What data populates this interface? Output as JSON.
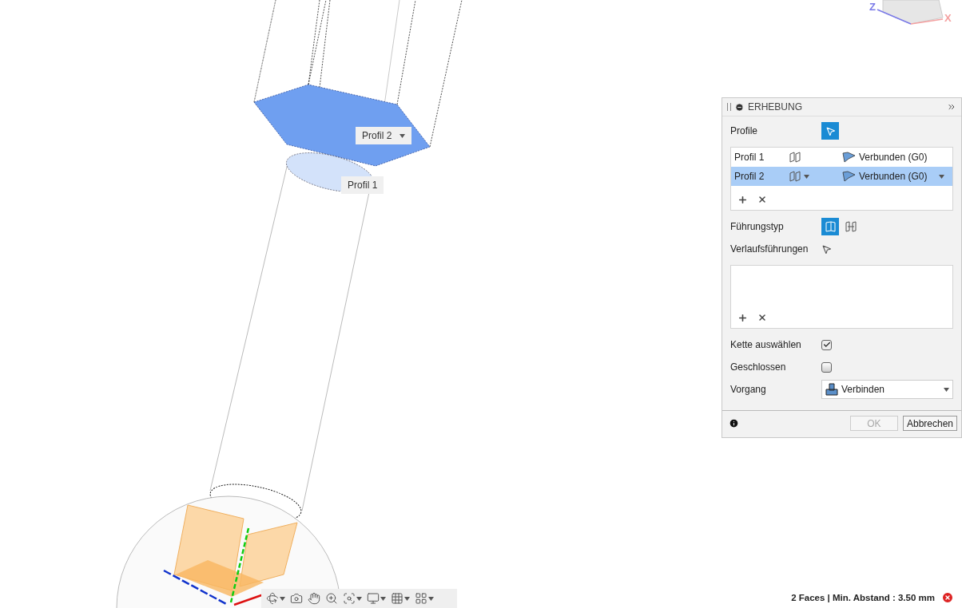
{
  "viewcube": {
    "axis_labels": [
      "Z",
      "X"
    ]
  },
  "viewport_labels": [
    {
      "text": "Profil 2",
      "dropdown": true
    },
    {
      "text": "Profil 1",
      "dropdown": false
    }
  ],
  "dialog": {
    "title": "ERHEBUNG",
    "profile_label": "Profile",
    "profile_select_active": true,
    "profiles": [
      {
        "name": "Profil 1",
        "selected": false,
        "continuity": "Verbunden (G0)"
      },
      {
        "name": "Profil 2",
        "selected": true,
        "continuity": "Verbunden (G0)"
      }
    ],
    "guide_type_label": "Führungstyp",
    "guide_types": [
      {
        "kind": "rails",
        "selected": true
      },
      {
        "kind": "centerline",
        "selected": false
      }
    ],
    "rails_label": "Verlaufsführungen",
    "checkboxes": [
      {
        "label": "Kette auswählen",
        "checked": true
      },
      {
        "label": "Geschlossen",
        "checked": false
      }
    ],
    "operation": {
      "label": "Vorgang",
      "value": "Verbinden"
    },
    "buttons": [
      {
        "label": "OK",
        "disabled": true
      },
      {
        "label": "Abbrechen",
        "disabled": false
      }
    ]
  },
  "status": {
    "text": "2 Faces | Min. Abstand : 3.50 mm"
  }
}
